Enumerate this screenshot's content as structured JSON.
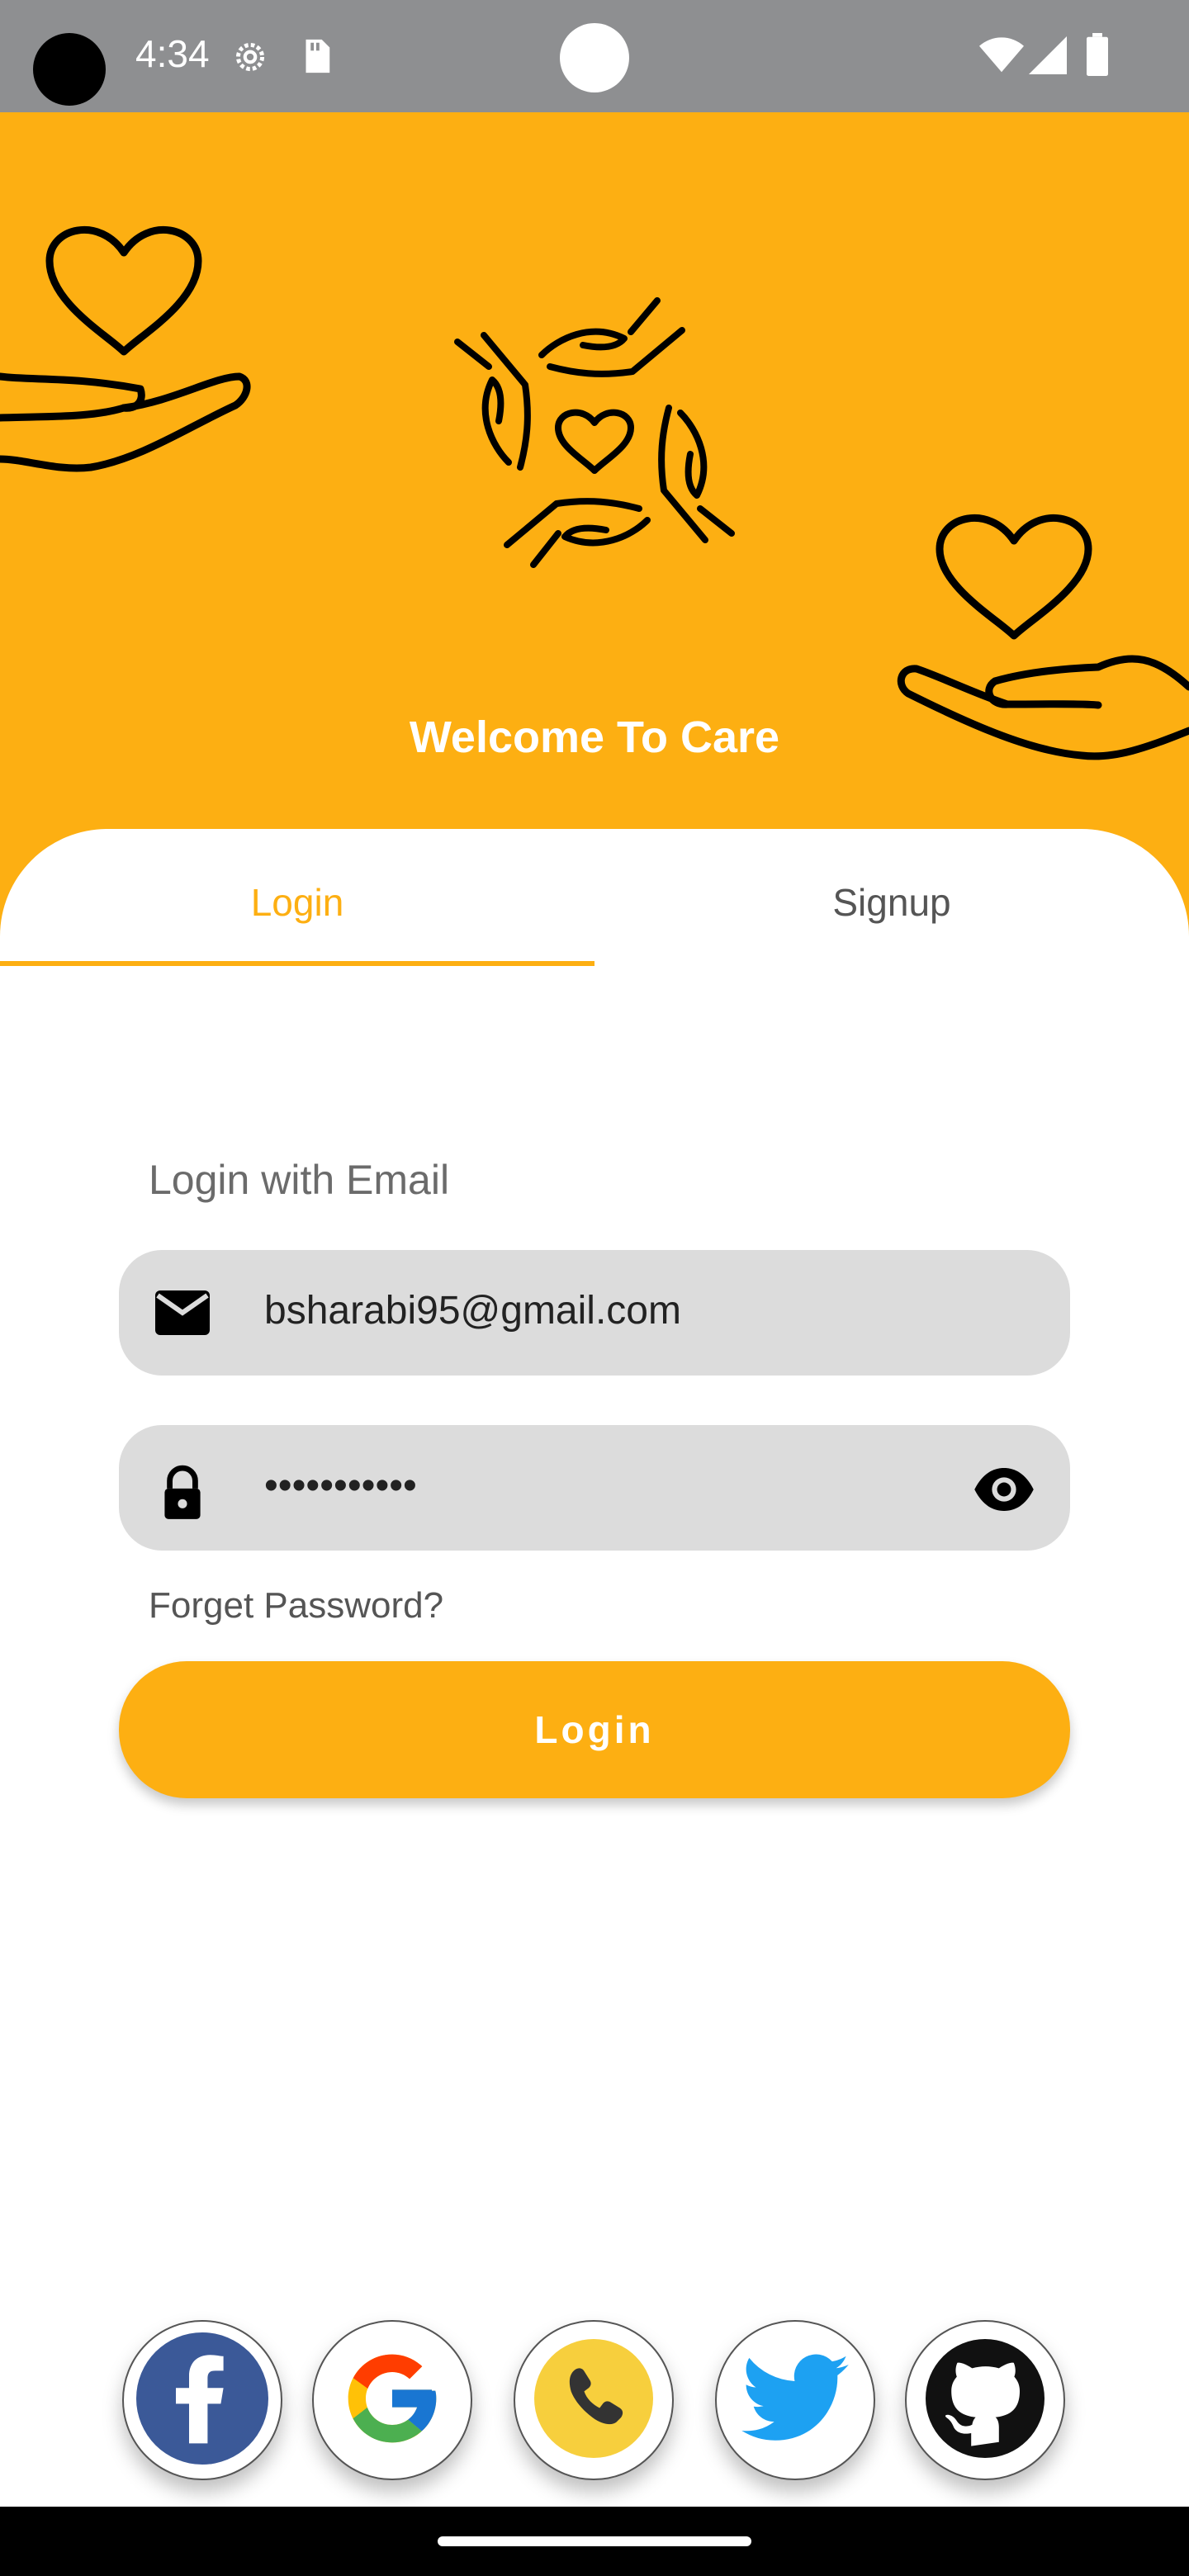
{
  "status_bar": {
    "time": "4:34",
    "icons": [
      "settings-gear-icon",
      "sd-card-icon",
      "wifi-icon",
      "signal-icon",
      "battery-icon"
    ]
  },
  "hero": {
    "title": "Welcome To Care",
    "background_color": "#fdaf12",
    "decorations": [
      "heart-in-hand-icon",
      "heart-in-hand-icon",
      "caring-hands-heart-logo"
    ]
  },
  "tabs": [
    {
      "label": "Login",
      "selected": true
    },
    {
      "label": "Signup",
      "selected": false
    }
  ],
  "form": {
    "section_label": "Login with Email",
    "email": {
      "value": "bsharabi95@gmail.com",
      "icon": "mail-icon"
    },
    "password": {
      "value": "•••••••••••",
      "icon": "lock-icon",
      "toggle_icon": "eye-icon"
    },
    "forgot_label": "Forget Password?",
    "submit_label": "Login"
  },
  "social_logins": [
    {
      "name": "facebook",
      "icon": "facebook-icon"
    },
    {
      "name": "google",
      "icon": "google-icon"
    },
    {
      "name": "phone",
      "icon": "phone-icon"
    },
    {
      "name": "twitter",
      "icon": "twitter-icon"
    },
    {
      "name": "github",
      "icon": "github-icon"
    }
  ],
  "colors": {
    "accent": "#fdaf12",
    "field_bg": "#dcdcdc",
    "facebook": "#3b5998",
    "twitter": "#1da1f2",
    "phone": "#f7cf3d"
  }
}
